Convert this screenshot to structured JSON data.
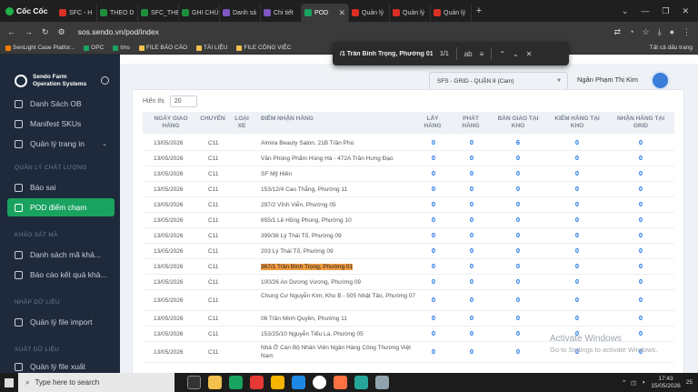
{
  "browser": {
    "brand": "Cốc Cốc",
    "tabs": [
      {
        "label": "SFC - H",
        "color": "#d93025"
      },
      {
        "label": "THEO D",
        "color": "#1e8e3e"
      },
      {
        "label": "SFC_THE",
        "color": "#1e8e3e"
      },
      {
        "label": "GHI CHÚ",
        "color": "#1e8e3e"
      },
      {
        "label": "Danh sá",
        "color": "#7e57c2"
      },
      {
        "label": "Chi tiết",
        "color": "#7e57c2"
      },
      {
        "label": "POD",
        "color": "#1aa260"
      },
      {
        "label": "Quản lý",
        "color": "#d93025"
      },
      {
        "label": "Quản lý",
        "color": "#d93025"
      },
      {
        "label": "Quản lý",
        "color": "#d93025"
      }
    ],
    "url": "sos.sendo.vn/pod/index",
    "bookmarks": [
      "SenLight Case Platfor...",
      "OPC",
      "tms",
      "FILE BÁO CÁO",
      "TÀI LIỆU",
      "FILE CÔNG VIỆC"
    ],
    "bookmarks_all": "Tất cả dấu trang"
  },
  "find": {
    "query": "/1 Trần Bình Trọng, Phường 01",
    "count": "1/1"
  },
  "sidebar": {
    "logo_line1": "Sendo Farm",
    "logo_line2": "Operation Systems",
    "items_top": [
      {
        "label": "Danh Sách OB"
      },
      {
        "label": "Manifest SKUs"
      },
      {
        "label": "Quản lý trang in"
      }
    ],
    "section_quality": "QUẢN LÝ CHẤT LƯỢNG",
    "items_quality": [
      {
        "label": "Báo sai"
      },
      {
        "label": "POD điểm chạm"
      }
    ],
    "section_survey": "KHẢO SÁT MÃ",
    "items_survey": [
      {
        "label": "Danh sách mã khả..."
      },
      {
        "label": "Báo cáo kết quả khả..."
      }
    ],
    "section_import": "NHẬP DỮ LIỆU",
    "items_import": [
      {
        "label": "Quản lý file import"
      }
    ],
    "section_export": "XUẤT DỮ LIỆU",
    "items_export": [
      {
        "label": "Quản lý file xuất"
      }
    ]
  },
  "header": {
    "filter": "SFS - GRID - QUẬN 8 (Cam)",
    "user": "Ngân Phạm Thị Kim"
  },
  "table": {
    "showing_label": "Hiển thị",
    "page_size": "20",
    "columns": [
      "NGÀY GIAO HÀNG",
      "CHUYẾN",
      "LOẠI XE",
      "ĐIỂM NHẬN HÀNG",
      "LẤY HÀNG",
      "PHÁT HÀNG",
      "BÀN GIAO TẠI KHO",
      "KIỂM HÀNG TẠI KHO",
      "NHẬN HÀNG TẠI GRID"
    ],
    "rows": [
      {
        "date": "13/05/2026",
        "trip": "C11",
        "place": "Almira Beauty Salon, 21B Trần Phú",
        "v": [
          "0",
          "0",
          "6",
          "0",
          "0"
        ]
      },
      {
        "date": "13/05/2026",
        "trip": "C11",
        "place": "Văn Phòng Phẩm Hùng Hà - 472A Trần Hưng Đạo",
        "v": [
          "0",
          "0",
          "0",
          "0",
          "0"
        ]
      },
      {
        "date": "13/05/2026",
        "trip": "C11",
        "place": "SF Mỹ Hiền",
        "v": [
          "0",
          "0",
          "0",
          "0",
          "0"
        ]
      },
      {
        "date": "13/05/2026",
        "trip": "C11",
        "place": "153/12/4 Cao Thắng, Phường 11",
        "v": [
          "0",
          "0",
          "0",
          "0",
          "0"
        ]
      },
      {
        "date": "13/05/2026",
        "trip": "C11",
        "place": "297/2 Vĩnh Viễn, Phường 05",
        "v": [
          "0",
          "0",
          "0",
          "0",
          "0"
        ]
      },
      {
        "date": "13/05/2026",
        "trip": "C11",
        "place": "655/1 Lê Hồng Phong, Phường 10",
        "v": [
          "0",
          "0",
          "0",
          "0",
          "0"
        ]
      },
      {
        "date": "13/05/2026",
        "trip": "C11",
        "place": "399/36 Lý Thái Tổ, Phường 09",
        "v": [
          "0",
          "0",
          "0",
          "0",
          "0"
        ]
      },
      {
        "date": "13/05/2026",
        "trip": "C11",
        "place": "203 Lý Thái Tổ, Phường 09",
        "v": [
          "0",
          "0",
          "0",
          "0",
          "0"
        ]
      },
      {
        "date": "13/05/2026",
        "trip": "C11",
        "place": "367/1 Trần Bình Trọng, Phường 01",
        "v": [
          "0",
          "0",
          "0",
          "0",
          "0"
        ]
      },
      {
        "date": "13/05/2026",
        "trip": "C11",
        "place": "100/26 An Dương Vương, Phường 09",
        "v": [
          "0",
          "0",
          "0",
          "0",
          "0"
        ]
      },
      {
        "date": "13/05/2026",
        "trip": "C11",
        "place": "Chung Cư Nguyễn Kim, Khu B - 505 Nhật Tảo, Phường 07",
        "v": [
          "0",
          "0",
          "0",
          "0",
          "0"
        ]
      },
      {
        "date": "13/05/2026",
        "trip": "C11",
        "place": "06 Trần Minh Quyền, Phường 11",
        "v": [
          "0",
          "0",
          "0",
          "0",
          "0"
        ]
      },
      {
        "date": "13/05/2026",
        "trip": "C11",
        "place": "153/25/10 Nguyễn Tiểu La, Phường 05",
        "v": [
          "0",
          "0",
          "0",
          "0",
          "0"
        ]
      },
      {
        "date": "13/05/2026",
        "trip": "C11",
        "place": "Nhà Ở Cán Bộ Nhân Viên Ngân Hàng Công Thương Việt Nam",
        "v": [
          "0",
          "0",
          "0",
          "0",
          "0"
        ]
      }
    ]
  },
  "watermark": {
    "title": "Activate Windows",
    "subtitle": "Go to Settings to activate Windows."
  },
  "taskbar": {
    "search_placeholder": "Type here to search",
    "time": "17:43",
    "date": "15/05/2026",
    "notif": "25"
  }
}
